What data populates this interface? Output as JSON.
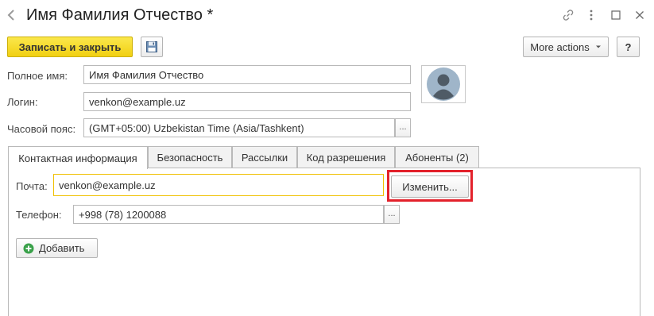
{
  "window": {
    "title": "Имя Фамилия Отчество *"
  },
  "toolbar": {
    "save_close_label": "Записать и закрыть",
    "more_actions_label": "More actions",
    "help_label": "?"
  },
  "form": {
    "full_name": {
      "label": "Полное имя:",
      "value": "Имя Фамилия Отчество"
    },
    "login": {
      "label": "Логин:",
      "value": "venkon@example.uz"
    },
    "timezone": {
      "label": "Часовой пояс:",
      "value": "(GMT+05:00) Uzbekistan Time (Asia/Tashkent)",
      "select_label": "..."
    }
  },
  "tabs": [
    {
      "label": "Контактная информация",
      "active": true
    },
    {
      "label": "Безопасность",
      "active": false
    },
    {
      "label": "Рассылки",
      "active": false
    },
    {
      "label": "Код разрешения",
      "active": false
    },
    {
      "label": "Абоненты (2)",
      "active": false
    }
  ],
  "contact": {
    "email": {
      "label": "Почта:",
      "value": "venkon@example.uz",
      "change_label": "Изменить..."
    },
    "phone": {
      "label": "Телефон:",
      "value": "+998 (78) 1200088",
      "select_label": "..."
    },
    "add_label": "Добавить"
  },
  "colors": {
    "primary_button": "#f5d90f",
    "highlight_frame": "#e3212b",
    "email_field_border": "#f0c000",
    "add_icon": "#3aa14a"
  },
  "icons": {
    "back": "arrow-left-icon",
    "forward": "arrow-right-icon",
    "star": "star-icon",
    "link": "link-icon",
    "menu": "vertical-dots-icon",
    "maximize": "maximize-icon",
    "close": "close-icon",
    "save": "floppy-disk-icon",
    "avatar": "user-avatar-icon",
    "add": "plus-circle-icon",
    "dropdown": "caret-down-icon"
  }
}
